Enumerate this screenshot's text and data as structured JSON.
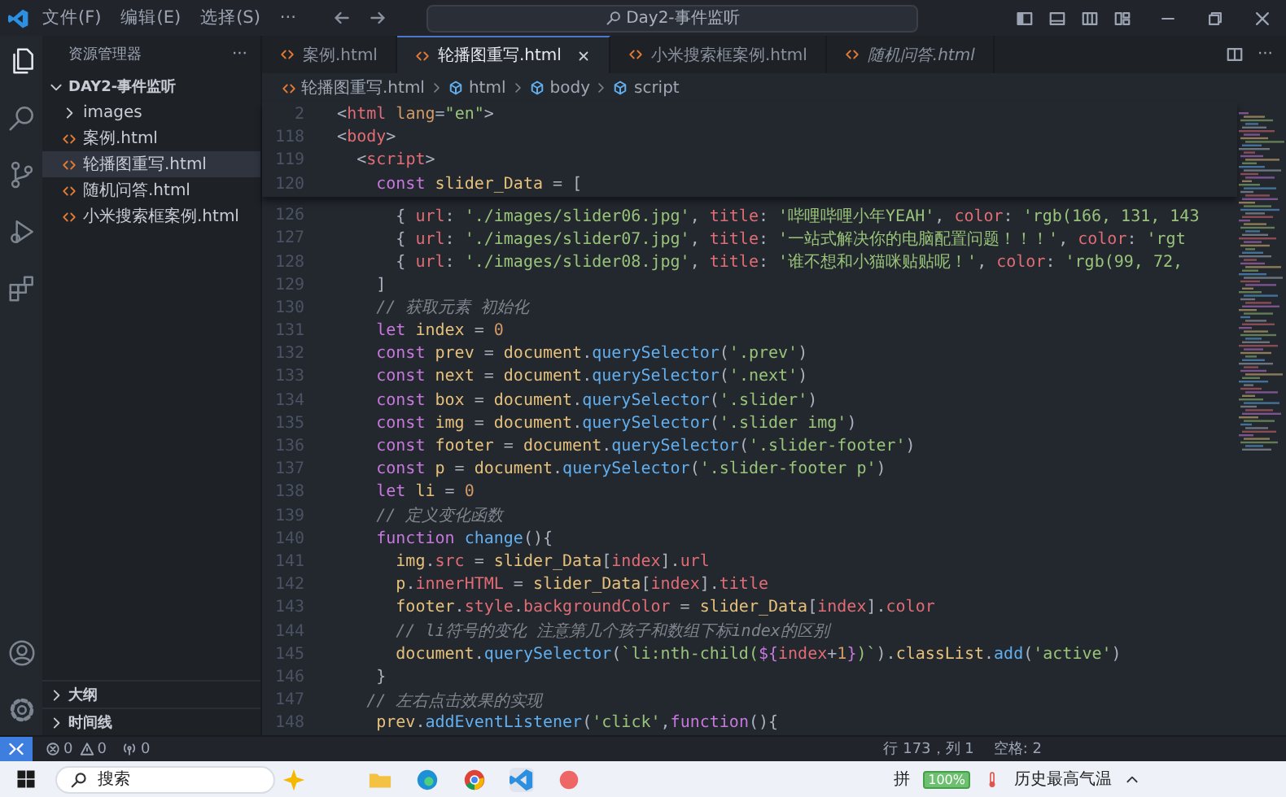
{
  "title_bar": {
    "menus": [
      "文件(F)",
      "编辑(E)",
      "选择(S)",
      "···"
    ],
    "search": "Day2-事件监听"
  },
  "activity_bar": {
    "items": [
      {
        "selected": true
      },
      {
        "selected": false
      },
      {
        "selected": false
      },
      {
        "selected": false
      },
      {
        "selected": false
      }
    ]
  },
  "sidebar": {
    "title": "资源管理器",
    "more": "···",
    "folder": {
      "label": "DAY2-事件监听",
      "expanded": true,
      "children": [
        {
          "label": "images",
          "kind": "folder",
          "expanded": false,
          "selected": false
        },
        {
          "label": "案例.html",
          "kind": "file",
          "selected": false
        },
        {
          "label": "轮播图重写.html",
          "kind": "file",
          "selected": true
        },
        {
          "label": "随机问答.html",
          "kind": "file",
          "selected": false
        },
        {
          "label": "小米搜索框案例.html",
          "kind": "file",
          "selected": false
        }
      ]
    },
    "sections": [
      {
        "label": "大纲",
        "expanded": false
      },
      {
        "label": "时间线",
        "expanded": false
      }
    ]
  },
  "tabs": [
    {
      "label": "案例.html",
      "selected": false,
      "preview": false
    },
    {
      "label": "轮播图重写.html",
      "selected": true,
      "preview": false
    },
    {
      "label": "小米搜索框案例.html",
      "selected": false,
      "preview": false
    },
    {
      "label": "随机问答.html",
      "selected": false,
      "preview": true
    }
  ],
  "tab_more": "···",
  "breadcrumb": [
    "轮播图重写.html",
    "html",
    "body",
    "script"
  ],
  "editor": {
    "sticky_lines": [
      {
        "number": "2",
        "tokens": [
          {
            "text": "  <",
            "kind": "punct"
          },
          {
            "text": "html",
            "kind": "tag"
          },
          {
            "text": " lang",
            "kind": "attr"
          },
          {
            "text": "=",
            "kind": "punct"
          },
          {
            "text": "\"en\"",
            "kind": "string"
          },
          {
            "text": ">",
            "kind": "punct"
          }
        ]
      },
      {
        "number": "118",
        "tokens": [
          {
            "text": "  <",
            "kind": "punct"
          },
          {
            "text": "body",
            "kind": "tag"
          },
          {
            "text": ">",
            "kind": "punct"
          }
        ]
      },
      {
        "number": "119",
        "tokens": [
          {
            "text": "    <",
            "kind": "punct"
          },
          {
            "text": "script",
            "kind": "tag"
          },
          {
            "text": ">",
            "kind": "punct"
          }
        ]
      },
      {
        "number": "120",
        "tokens": [
          {
            "text": "      const",
            "kind": "keyword"
          },
          {
            "text": " slider_Data",
            "kind": "variable"
          },
          {
            "text": " = [",
            "kind": "punct"
          }
        ]
      }
    ],
    "lines": [
      {
        "number": "126",
        "tokens": [
          {
            "text": "        { ",
            "kind": "punct"
          },
          {
            "text": "url",
            "kind": "property"
          },
          {
            "text": ": ",
            "kind": "punct"
          },
          {
            "text": "'./images/slider06.jpg'",
            "kind": "string"
          },
          {
            "text": ", ",
            "kind": "punct"
          },
          {
            "text": "title",
            "kind": "property"
          },
          {
            "text": ": ",
            "kind": "punct"
          },
          {
            "text": "'哔哩哔哩小年YEAH'",
            "kind": "string"
          },
          {
            "text": ", ",
            "kind": "punct"
          },
          {
            "text": "color",
            "kind": "property"
          },
          {
            "text": ": ",
            "kind": "punct"
          },
          {
            "text": "'rgb(166, 131, 143",
            "kind": "string"
          }
        ]
      },
      {
        "number": "127",
        "tokens": [
          {
            "text": "        { ",
            "kind": "punct"
          },
          {
            "text": "url",
            "kind": "property"
          },
          {
            "text": ": ",
            "kind": "punct"
          },
          {
            "text": "'./images/slider07.jpg'",
            "kind": "string"
          },
          {
            "text": ", ",
            "kind": "punct"
          },
          {
            "text": "title",
            "kind": "property"
          },
          {
            "text": ": ",
            "kind": "punct"
          },
          {
            "text": "'一站式解决你的电脑配置问题！！！'",
            "kind": "string"
          },
          {
            "text": ", ",
            "kind": "punct"
          },
          {
            "text": "color",
            "kind": "property"
          },
          {
            "text": ": ",
            "kind": "punct"
          },
          {
            "text": "'rgt",
            "kind": "string"
          }
        ]
      },
      {
        "number": "128",
        "tokens": [
          {
            "text": "        { ",
            "kind": "punct"
          },
          {
            "text": "url",
            "kind": "property"
          },
          {
            "text": ": ",
            "kind": "punct"
          },
          {
            "text": "'./images/slider08.jpg'",
            "kind": "string"
          },
          {
            "text": ", ",
            "kind": "punct"
          },
          {
            "text": "title",
            "kind": "property"
          },
          {
            "text": ": ",
            "kind": "punct"
          },
          {
            "text": "'谁不想和小猫咪贴贴呢！'",
            "kind": "string"
          },
          {
            "text": ", ",
            "kind": "punct"
          },
          {
            "text": "color",
            "kind": "property"
          },
          {
            "text": ": ",
            "kind": "punct"
          },
          {
            "text": "'rgb(99, 72,",
            "kind": "string"
          }
        ]
      },
      {
        "number": "129",
        "tokens": [
          {
            "text": "      ]",
            "kind": "punct"
          }
        ]
      },
      {
        "number": "130",
        "tokens": [
          {
            "text": "      // 获取元素 初始化",
            "kind": "comment"
          }
        ]
      },
      {
        "number": "131",
        "tokens": [
          {
            "text": "      let",
            "kind": "keyword"
          },
          {
            "text": " index",
            "kind": "variable"
          },
          {
            "text": " = ",
            "kind": "punct"
          },
          {
            "text": "0",
            "kind": "number"
          }
        ]
      },
      {
        "number": "132",
        "tokens": [
          {
            "text": "      const",
            "kind": "keyword"
          },
          {
            "text": " prev",
            "kind": "variable"
          },
          {
            "text": " = ",
            "kind": "punct"
          },
          {
            "text": "document",
            "kind": "object"
          },
          {
            "text": ".",
            "kind": "punct"
          },
          {
            "text": "querySelector",
            "kind": "function"
          },
          {
            "text": "(",
            "kind": "punct"
          },
          {
            "text": "'.prev'",
            "kind": "string"
          },
          {
            "text": ")",
            "kind": "punct"
          }
        ]
      },
      {
        "number": "133",
        "tokens": [
          {
            "text": "      const",
            "kind": "keyword"
          },
          {
            "text": " next",
            "kind": "variable"
          },
          {
            "text": " = ",
            "kind": "punct"
          },
          {
            "text": "document",
            "kind": "object"
          },
          {
            "text": ".",
            "kind": "punct"
          },
          {
            "text": "querySelector",
            "kind": "function"
          },
          {
            "text": "(",
            "kind": "punct"
          },
          {
            "text": "'.next'",
            "kind": "string"
          },
          {
            "text": ")",
            "kind": "punct"
          }
        ]
      },
      {
        "number": "134",
        "tokens": [
          {
            "text": "      const",
            "kind": "keyword"
          },
          {
            "text": " box",
            "kind": "variable"
          },
          {
            "text": " = ",
            "kind": "punct"
          },
          {
            "text": "document",
            "kind": "object"
          },
          {
            "text": ".",
            "kind": "punct"
          },
          {
            "text": "querySelector",
            "kind": "function"
          },
          {
            "text": "(",
            "kind": "punct"
          },
          {
            "text": "'.slider'",
            "kind": "string"
          },
          {
            "text": ")",
            "kind": "punct"
          }
        ]
      },
      {
        "number": "135",
        "tokens": [
          {
            "text": "      const",
            "kind": "keyword"
          },
          {
            "text": " img",
            "kind": "variable"
          },
          {
            "text": " = ",
            "kind": "punct"
          },
          {
            "text": "document",
            "kind": "object"
          },
          {
            "text": ".",
            "kind": "punct"
          },
          {
            "text": "querySelector",
            "kind": "function"
          },
          {
            "text": "(",
            "kind": "punct"
          },
          {
            "text": "'.slider img'",
            "kind": "string"
          },
          {
            "text": ")",
            "kind": "punct"
          }
        ]
      },
      {
        "number": "136",
        "tokens": [
          {
            "text": "      const",
            "kind": "keyword"
          },
          {
            "text": " footer",
            "kind": "variable"
          },
          {
            "text": " = ",
            "kind": "punct"
          },
          {
            "text": "document",
            "kind": "object"
          },
          {
            "text": ".",
            "kind": "punct"
          },
          {
            "text": "querySelector",
            "kind": "function"
          },
          {
            "text": "(",
            "kind": "punct"
          },
          {
            "text": "'.slider-footer'",
            "kind": "string"
          },
          {
            "text": ")",
            "kind": "punct"
          }
        ]
      },
      {
        "number": "137",
        "tokens": [
          {
            "text": "      const",
            "kind": "keyword"
          },
          {
            "text": " p",
            "kind": "variable"
          },
          {
            "text": " = ",
            "kind": "punct"
          },
          {
            "text": "document",
            "kind": "object"
          },
          {
            "text": ".",
            "kind": "punct"
          },
          {
            "text": "querySelector",
            "kind": "function"
          },
          {
            "text": "(",
            "kind": "punct"
          },
          {
            "text": "'.slider-footer p'",
            "kind": "string"
          },
          {
            "text": ")",
            "kind": "punct"
          }
        ]
      },
      {
        "number": "138",
        "tokens": [
          {
            "text": "      let",
            "kind": "keyword"
          },
          {
            "text": " li",
            "kind": "variable"
          },
          {
            "text": " = ",
            "kind": "punct"
          },
          {
            "text": "0",
            "kind": "number"
          }
        ]
      },
      {
        "number": "139",
        "tokens": [
          {
            "text": "      // 定义变化函数",
            "kind": "comment"
          }
        ]
      },
      {
        "number": "140",
        "tokens": [
          {
            "text": "      function",
            "kind": "keyword"
          },
          {
            "text": " change",
            "kind": "function"
          },
          {
            "text": "(){",
            "kind": "punct"
          }
        ]
      },
      {
        "number": "141",
        "tokens": [
          {
            "text": "        img",
            "kind": "object"
          },
          {
            "text": ".",
            "kind": "punct"
          },
          {
            "text": "src",
            "kind": "property"
          },
          {
            "text": " = ",
            "kind": "punct"
          },
          {
            "text": "slider_Data",
            "kind": "object"
          },
          {
            "text": "[",
            "kind": "punct"
          },
          {
            "text": "index",
            "kind": "property"
          },
          {
            "text": "].",
            "kind": "punct"
          },
          {
            "text": "url",
            "kind": "property"
          }
        ]
      },
      {
        "number": "142",
        "tokens": [
          {
            "text": "        p",
            "kind": "object"
          },
          {
            "text": ".",
            "kind": "punct"
          },
          {
            "text": "innerHTML",
            "kind": "property"
          },
          {
            "text": " = ",
            "kind": "punct"
          },
          {
            "text": "slider_Data",
            "kind": "object"
          },
          {
            "text": "[",
            "kind": "punct"
          },
          {
            "text": "index",
            "kind": "property"
          },
          {
            "text": "].",
            "kind": "punct"
          },
          {
            "text": "title",
            "kind": "property"
          }
        ]
      },
      {
        "number": "143",
        "tokens": [
          {
            "text": "        footer",
            "kind": "object"
          },
          {
            "text": ".",
            "kind": "punct"
          },
          {
            "text": "style",
            "kind": "property"
          },
          {
            "text": ".",
            "kind": "punct"
          },
          {
            "text": "backgroundColor",
            "kind": "property"
          },
          {
            "text": " = ",
            "kind": "punct"
          },
          {
            "text": "slider_Data",
            "kind": "object"
          },
          {
            "text": "[",
            "kind": "punct"
          },
          {
            "text": "index",
            "kind": "property"
          },
          {
            "text": "].",
            "kind": "punct"
          },
          {
            "text": "color",
            "kind": "property"
          }
        ]
      },
      {
        "number": "144",
        "tokens": [
          {
            "text": "        // li符号的变化 注意第几个孩子和数组下标index的区别",
            "kind": "comment"
          }
        ]
      },
      {
        "number": "145",
        "tokens": [
          {
            "text": "        document",
            "kind": "object"
          },
          {
            "text": ".",
            "kind": "punct"
          },
          {
            "text": "querySelector",
            "kind": "function"
          },
          {
            "text": "(",
            "kind": "punct"
          },
          {
            "text": "`li:nth-child(",
            "kind": "string"
          },
          {
            "text": "${",
            "kind": "keyword"
          },
          {
            "text": "index",
            "kind": "property"
          },
          {
            "text": "+",
            "kind": "punct"
          },
          {
            "text": "1",
            "kind": "number"
          },
          {
            "text": "}",
            "kind": "keyword"
          },
          {
            "text": ")`",
            "kind": "string"
          },
          {
            "text": ").",
            "kind": "punct"
          },
          {
            "text": "classList",
            "kind": "object"
          },
          {
            "text": ".",
            "kind": "punct"
          },
          {
            "text": "add",
            "kind": "function"
          },
          {
            "text": "(",
            "kind": "punct"
          },
          {
            "text": "'active'",
            "kind": "string"
          },
          {
            "text": ")",
            "kind": "punct"
          }
        ]
      },
      {
        "number": "146",
        "tokens": [
          {
            "text": "      }",
            "kind": "punct"
          }
        ]
      },
      {
        "number": "147",
        "tokens": [
          {
            "text": "     // 左右点击效果的实现",
            "kind": "comment"
          }
        ]
      },
      {
        "number": "148",
        "tokens": [
          {
            "text": "      prev",
            "kind": "variable"
          },
          {
            "text": ".",
            "kind": "punct"
          },
          {
            "text": "addEventListener",
            "kind": "function"
          },
          {
            "text": "(",
            "kind": "punct"
          },
          {
            "text": "'click'",
            "kind": "string"
          },
          {
            "text": ",",
            "kind": "punct"
          },
          {
            "text": "function",
            "kind": "keyword"
          },
          {
            "text": "(){",
            "kind": "punct"
          }
        ]
      }
    ]
  },
  "status_bar": {
    "errors": "0",
    "warnings": "0",
    "ports": "0",
    "position": "行 173，列 1",
    "indent": "空格: 2"
  },
  "taskbar": {
    "search": "搜索",
    "ime": "拼",
    "battery": "100%",
    "weather": "历史最高气温"
  }
}
